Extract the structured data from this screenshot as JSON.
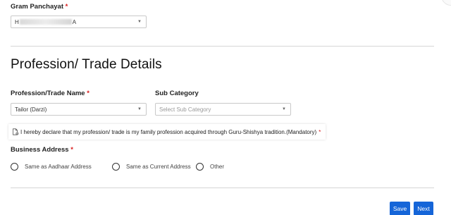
{
  "gram_panchayat": {
    "label": "Gram Panchayat",
    "required_mark": "*",
    "value_prefix": "H",
    "value_suffix": "A"
  },
  "section": {
    "title": "Profession/ Trade Details"
  },
  "profession": {
    "label": "Profession/Trade Name",
    "required_mark": "*",
    "value": "Tailor (Darzi)"
  },
  "sub_category": {
    "label": "Sub Category",
    "placeholder": "Select Sub Category"
  },
  "declaration": {
    "text": "I hereby declare that my profession/ trade is my family profession acquired through Guru-Shishya tradition.(Mandatory)",
    "required_mark": "*",
    "icon": "document-icon"
  },
  "business_address": {
    "label": "Business Address",
    "required_mark": "*",
    "options": [
      "Same as Aadhaar Address",
      "Same as Current Address",
      "Other"
    ]
  },
  "buttons": {
    "save": "Save",
    "next": "Next"
  },
  "colors": {
    "primary": "#1565d8",
    "required": "#d81b1b",
    "divider": "#d6d6d6"
  }
}
